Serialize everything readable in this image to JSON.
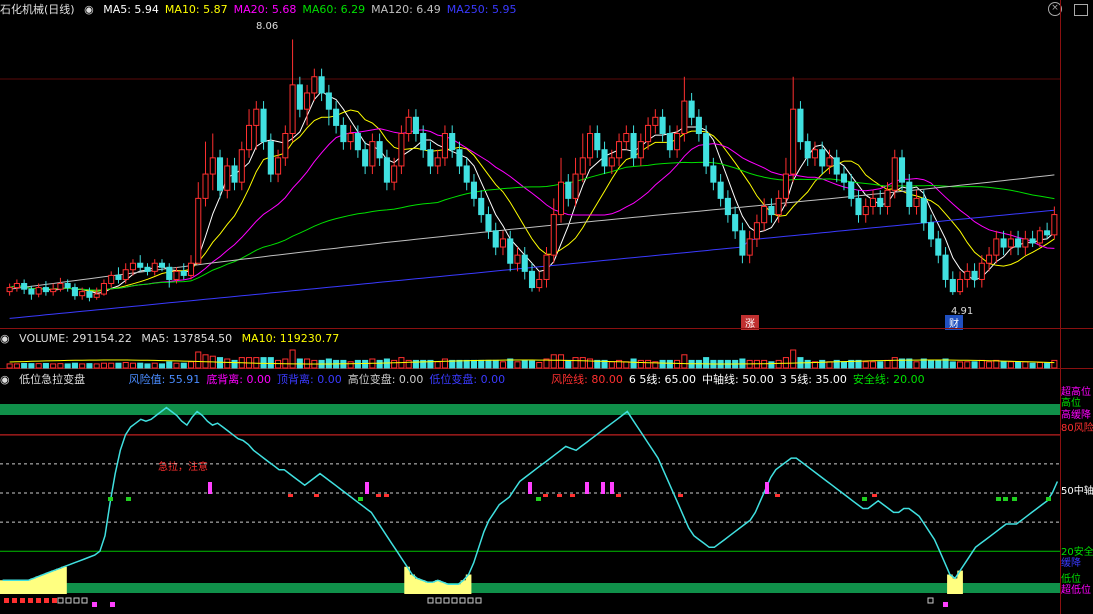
{
  "main": {
    "title": "石化机械(日线)",
    "ma": [
      {
        "label": "MA5: 5.94",
        "color": "#ffffff"
      },
      {
        "label": "MA10: 5.87",
        "color": "#ffff00"
      },
      {
        "label": "MA20: 5.68",
        "color": "#ff00ff"
      },
      {
        "label": "MA60: 6.29",
        "color": "#00e000"
      },
      {
        "label": "MA120: 6.49",
        "color": "#c0c0c0"
      },
      {
        "label": "MA250: 5.95",
        "color": "#3a3aff"
      }
    ],
    "high_label": "8.06",
    "low_label": "4.91",
    "tag_zhang": "涨",
    "tag_cai": "财"
  },
  "volume": {
    "title": "VOLUME: 291154.22",
    "ma5": "MA5: 137854.50",
    "ma10": "MA10: 119230.77"
  },
  "indicator": {
    "title": "低位急拉变盘",
    "items": [
      {
        "label": "风险值: 55.91",
        "color": "#4a8cff"
      },
      {
        "label": "底背离: 0.00",
        "color": "#ff00ff"
      },
      {
        "label": "顶背离: 0.00",
        "color": "#3a3aff"
      },
      {
        "label": "高位变盘: 0.00",
        "color": "#cccccc"
      },
      {
        "label": "低位变盘: 0.00",
        "color": "#3a3aff"
      },
      {
        "label": "风险线: 80.00",
        "color": "#ff3030"
      },
      {
        "label": "6 5线: 65.00",
        "color": "#ffffff"
      },
      {
        "label": "中轴线: 50.00",
        "color": "#ffffff"
      },
      {
        "label": "3 5线: 35.00",
        "color": "#ffffff"
      },
      {
        "label": "安全线: 20.00",
        "color": "#00e000"
      }
    ],
    "annotation": "急拉，注意",
    "right_labels": [
      {
        "text": "超高位",
        "color": "#ff00ff"
      },
      {
        "text": "高位",
        "color": "#00e000"
      },
      {
        "text": "高缓降",
        "color": "#ff00ff"
      },
      {
        "text": "80风险",
        "color": "#ff3030"
      },
      {
        "text": "50中轴",
        "color": "#ffffff"
      },
      {
        "text": "20安全",
        "color": "#00e000"
      },
      {
        "text": "缓降",
        "color": "#3a3aff"
      },
      {
        "text": "低位",
        "color": "#00e000"
      },
      {
        "text": "超低位",
        "color": "#ff00ff"
      }
    ]
  },
  "chart_data": {
    "type": "candlestick",
    "price_range": [
      4.6,
      8.3
    ],
    "candles": [
      [
        4.95,
        5.0,
        5.05,
        4.9
      ],
      [
        5.0,
        5.05,
        5.1,
        4.95
      ],
      [
        5.05,
        4.98,
        5.1,
        4.92
      ],
      [
        4.98,
        4.92,
        5.02,
        4.85
      ],
      [
        4.92,
        5.0,
        5.05,
        4.88
      ],
      [
        5.0,
        4.95,
        5.08,
        4.9
      ],
      [
        4.95,
        4.98,
        5.05,
        4.9
      ],
      [
        4.98,
        5.05,
        5.12,
        4.95
      ],
      [
        5.05,
        5.0,
        5.1,
        4.95
      ],
      [
        5.0,
        4.9,
        5.05,
        4.85
      ],
      [
        4.9,
        4.95,
        5.0,
        4.85
      ],
      [
        4.95,
        4.88,
        5.0,
        4.83
      ],
      [
        4.88,
        4.92,
        5.0,
        4.85
      ],
      [
        4.92,
        5.05,
        5.1,
        4.9
      ],
      [
        5.05,
        5.15,
        5.2,
        5.0
      ],
      [
        5.15,
        5.1,
        5.25,
        5.05
      ],
      [
        5.1,
        5.22,
        5.3,
        5.05
      ],
      [
        5.22,
        5.3,
        5.35,
        5.15
      ],
      [
        5.3,
        5.25,
        5.4,
        5.2
      ],
      [
        5.25,
        5.2,
        5.3,
        5.15
      ],
      [
        5.2,
        5.3,
        5.35,
        5.15
      ],
      [
        5.3,
        5.25,
        5.35,
        5.2
      ],
      [
        5.25,
        5.1,
        5.3,
        5.0
      ],
      [
        5.1,
        5.2,
        5.25,
        5.05
      ],
      [
        5.2,
        5.15,
        5.3,
        5.1
      ],
      [
        5.15,
        5.3,
        5.4,
        5.1
      ],
      [
        5.3,
        6.1,
        6.3,
        5.3
      ],
      [
        6.1,
        6.4,
        6.8,
        6.0
      ],
      [
        6.4,
        6.6,
        6.9,
        6.2
      ],
      [
        6.6,
        6.2,
        6.7,
        6.1
      ],
      [
        6.2,
        6.5,
        6.6,
        6.1
      ],
      [
        6.5,
        6.3,
        6.6,
        6.2
      ],
      [
        6.3,
        6.7,
        6.8,
        6.2
      ],
      [
        6.7,
        7.0,
        7.2,
        6.6
      ],
      [
        7.0,
        7.2,
        7.3,
        6.7
      ],
      [
        7.2,
        6.8,
        7.3,
        6.7
      ],
      [
        6.8,
        6.4,
        6.9,
        6.3
      ],
      [
        6.4,
        6.6,
        6.7,
        6.3
      ],
      [
        6.6,
        6.9,
        7.0,
        6.5
      ],
      [
        6.9,
        7.5,
        8.06,
        6.8
      ],
      [
        7.5,
        7.2,
        7.6,
        7.1
      ],
      [
        7.2,
        7.4,
        7.5,
        7.0
      ],
      [
        7.4,
        7.6,
        7.7,
        7.3
      ],
      [
        7.6,
        7.4,
        7.7,
        7.3
      ],
      [
        7.4,
        7.2,
        7.5,
        7.0
      ],
      [
        7.2,
        7.0,
        7.3,
        6.9
      ],
      [
        7.0,
        6.8,
        7.1,
        6.7
      ],
      [
        6.8,
        6.9,
        7.0,
        6.7
      ],
      [
        6.9,
        6.7,
        7.0,
        6.6
      ],
      [
        6.7,
        6.5,
        6.8,
        6.4
      ],
      [
        6.5,
        6.8,
        6.9,
        6.4
      ],
      [
        6.8,
        6.6,
        6.9,
        6.5
      ],
      [
        6.6,
        6.3,
        6.7,
        6.2
      ],
      [
        6.3,
        6.5,
        6.6,
        6.2
      ],
      [
        6.5,
        6.9,
        7.0,
        6.4
      ],
      [
        6.9,
        7.1,
        7.2,
        6.8
      ],
      [
        7.1,
        6.9,
        7.2,
        6.8
      ],
      [
        6.9,
        6.7,
        7.0,
        6.6
      ],
      [
        6.7,
        6.5,
        6.8,
        6.4
      ],
      [
        6.5,
        6.6,
        6.7,
        6.4
      ],
      [
        6.6,
        6.9,
        7.0,
        6.5
      ],
      [
        6.9,
        6.7,
        7.0,
        6.6
      ],
      [
        6.7,
        6.5,
        6.8,
        6.4
      ],
      [
        6.5,
        6.3,
        6.6,
        6.2
      ],
      [
        6.3,
        6.1,
        6.4,
        6.0
      ],
      [
        6.1,
        5.9,
        6.2,
        5.8
      ],
      [
        5.9,
        5.7,
        6.0,
        5.6
      ],
      [
        5.7,
        5.5,
        5.8,
        5.4
      ],
      [
        5.5,
        5.6,
        5.7,
        5.4
      ],
      [
        5.6,
        5.3,
        5.7,
        5.2
      ],
      [
        5.3,
        5.4,
        5.5,
        5.2
      ],
      [
        5.4,
        5.2,
        5.5,
        5.1
      ],
      [
        5.2,
        5.0,
        5.3,
        4.95
      ],
      [
        5.0,
        5.1,
        5.2,
        4.95
      ],
      [
        5.1,
        5.4,
        5.5,
        5.0
      ],
      [
        5.4,
        5.9,
        6.1,
        5.3
      ],
      [
        5.9,
        6.3,
        6.6,
        5.8
      ],
      [
        6.3,
        6.1,
        6.4,
        6.0
      ],
      [
        6.1,
        6.4,
        6.6,
        6.0
      ],
      [
        6.4,
        6.6,
        6.9,
        6.3
      ],
      [
        6.6,
        6.9,
        7.0,
        6.5
      ],
      [
        6.9,
        6.7,
        7.0,
        6.6
      ],
      [
        6.7,
        6.5,
        6.8,
        6.4
      ],
      [
        6.5,
        6.6,
        6.7,
        6.4
      ],
      [
        6.6,
        6.8,
        6.9,
        6.5
      ],
      [
        6.8,
        6.9,
        7.0,
        6.7
      ],
      [
        6.9,
        6.6,
        7.0,
        6.5
      ],
      [
        6.6,
        6.8,
        6.9,
        6.5
      ],
      [
        6.8,
        7.0,
        7.1,
        6.7
      ],
      [
        7.0,
        7.1,
        7.2,
        6.9
      ],
      [
        7.1,
        6.9,
        7.2,
        6.8
      ],
      [
        6.9,
        6.7,
        7.0,
        6.6
      ],
      [
        6.7,
        6.9,
        7.0,
        6.6
      ],
      [
        6.9,
        7.3,
        7.6,
        6.8
      ],
      [
        7.3,
        7.1,
        7.4,
        7.0
      ],
      [
        7.1,
        6.9,
        7.2,
        6.8
      ],
      [
        6.9,
        6.5,
        7.0,
        6.4
      ],
      [
        6.5,
        6.3,
        6.6,
        6.2
      ],
      [
        6.3,
        6.1,
        6.4,
        6.0
      ],
      [
        6.1,
        5.9,
        6.2,
        5.8
      ],
      [
        5.9,
        5.7,
        6.0,
        5.6
      ],
      [
        5.7,
        5.4,
        5.8,
        5.3
      ],
      [
        5.4,
        5.6,
        5.7,
        5.3
      ],
      [
        5.6,
        5.8,
        5.9,
        5.5
      ],
      [
        5.8,
        6.0,
        6.1,
        5.7
      ],
      [
        6.0,
        5.9,
        6.1,
        5.8
      ],
      [
        5.9,
        6.1,
        6.2,
        5.8
      ],
      [
        6.1,
        6.4,
        6.6,
        6.0
      ],
      [
        6.4,
        7.2,
        7.6,
        6.3
      ],
      [
        7.2,
        6.8,
        7.3,
        6.7
      ],
      [
        6.8,
        6.6,
        6.9,
        6.5
      ],
      [
        6.6,
        6.7,
        6.8,
        6.5
      ],
      [
        6.7,
        6.5,
        6.8,
        6.4
      ],
      [
        6.5,
        6.6,
        6.7,
        6.4
      ],
      [
        6.6,
        6.4,
        6.7,
        6.3
      ],
      [
        6.4,
        6.3,
        6.5,
        6.2
      ],
      [
        6.3,
        6.1,
        6.4,
        6.0
      ],
      [
        6.1,
        5.9,
        6.2,
        5.8
      ],
      [
        5.9,
        6.0,
        6.1,
        5.8
      ],
      [
        6.0,
        6.1,
        6.2,
        5.9
      ],
      [
        6.1,
        6.0,
        6.2,
        5.9
      ],
      [
        6.0,
        6.2,
        6.3,
        5.9
      ],
      [
        6.2,
        6.6,
        6.7,
        6.1
      ],
      [
        6.6,
        6.3,
        6.7,
        6.2
      ],
      [
        6.3,
        6.0,
        6.4,
        5.9
      ],
      [
        6.0,
        6.1,
        6.2,
        5.9
      ],
      [
        6.1,
        5.8,
        6.2,
        5.7
      ],
      [
        5.8,
        5.6,
        5.9,
        5.5
      ],
      [
        5.6,
        5.4,
        5.7,
        5.3
      ],
      [
        5.4,
        5.1,
        5.5,
        5.0
      ],
      [
        5.1,
        4.95,
        5.2,
        4.91
      ],
      [
        4.95,
        5.1,
        5.2,
        4.91
      ],
      [
        5.1,
        5.2,
        5.3,
        5.0
      ],
      [
        5.2,
        5.1,
        5.3,
        5.0
      ],
      [
        5.1,
        5.3,
        5.4,
        5.0
      ],
      [
        5.3,
        5.4,
        5.5,
        5.2
      ],
      [
        5.4,
        5.6,
        5.7,
        5.3
      ],
      [
        5.6,
        5.5,
        5.7,
        5.4
      ],
      [
        5.5,
        5.6,
        5.7,
        5.4
      ],
      [
        5.6,
        5.5,
        5.7,
        5.4
      ],
      [
        5.5,
        5.6,
        5.7,
        5.4
      ],
      [
        5.6,
        5.55,
        5.7,
        5.5
      ],
      [
        5.55,
        5.7,
        5.75,
        5.5
      ],
      [
        5.7,
        5.65,
        5.8,
        5.6
      ],
      [
        5.65,
        5.9,
        6.0,
        5.6
      ]
    ],
    "risk_series": [
      5,
      5,
      5,
      5,
      5,
      5,
      6,
      7,
      8,
      9,
      10,
      11,
      12,
      13,
      14,
      15,
      16,
      17,
      18,
      20,
      28,
      45,
      60,
      72,
      80,
      84,
      86,
      88,
      87,
      88,
      90,
      92,
      94,
      92,
      90,
      87,
      85,
      89,
      92,
      90,
      87,
      85,
      86,
      84,
      82,
      80,
      78,
      77,
      75,
      72,
      70,
      68,
      66,
      64,
      62,
      62,
      60,
      58,
      56,
      54,
      56,
      58,
      60,
      58,
      56,
      54,
      52,
      50,
      48,
      46,
      44,
      42,
      40,
      36,
      32,
      28,
      24,
      20,
      16,
      12,
      8,
      6,
      5,
      4,
      4,
      5,
      4,
      3,
      3,
      3,
      5,
      8,
      14,
      22,
      30,
      36,
      40,
      44,
      46,
      48,
      52,
      56,
      58,
      60,
      62,
      64,
      66,
      68,
      70,
      72,
      74,
      73,
      72,
      74,
      76,
      78,
      80,
      82,
      84,
      86,
      88,
      90,
      92,
      88,
      84,
      80,
      76,
      72,
      68,
      62,
      56,
      50,
      44,
      38,
      32,
      28,
      26,
      24,
      22,
      22,
      24,
      26,
      28,
      30,
      32,
      34,
      36,
      40,
      46,
      52,
      58,
      62,
      64,
      66,
      68,
      68,
      66,
      64,
      62,
      60,
      58,
      56,
      54,
      52,
      50,
      48,
      46,
      44,
      42,
      42,
      44,
      46,
      44,
      42,
      40,
      40,
      42,
      42,
      40,
      38,
      34,
      30,
      26,
      20,
      14,
      8,
      6,
      10,
      14,
      18,
      22,
      24,
      26,
      28,
      30,
      32,
      34,
      34,
      34,
      36,
      38,
      40,
      42,
      44,
      46,
      50,
      55.91
    ]
  }
}
